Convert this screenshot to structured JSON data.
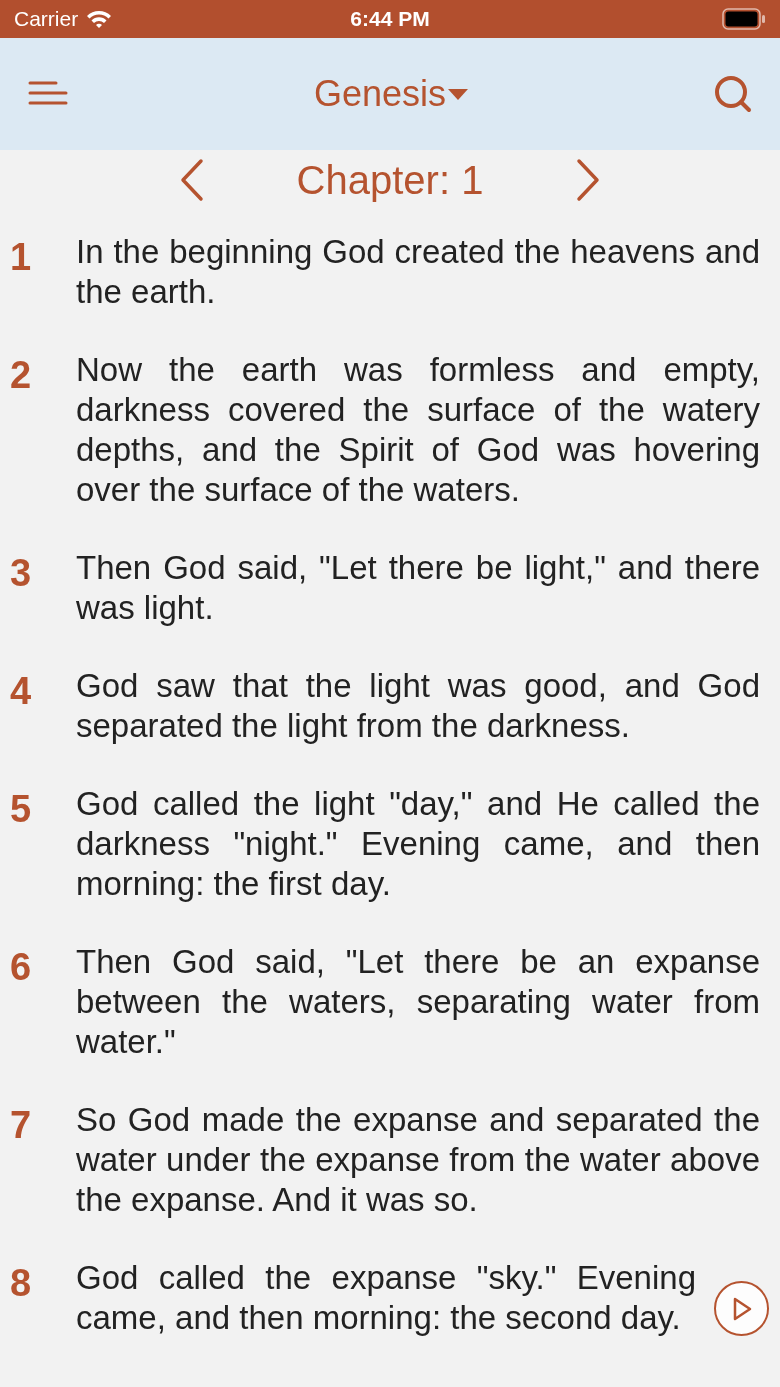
{
  "status_bar": {
    "carrier": "Carrier",
    "time": "6:44 PM"
  },
  "nav_bar": {
    "book": "Genesis"
  },
  "chapter_bar": {
    "label": "Chapter: 1"
  },
  "verses": [
    {
      "number": "1",
      "text": "In the beginning God created the heavens and the earth."
    },
    {
      "number": "2",
      "text": "Now the earth was formless and empty, darkness covered the surface of the watery depths, and the Spirit of God was hovering over the surface of the waters."
    },
    {
      "number": "3",
      "text": "Then God said, \"Let there be light,\" and there was light."
    },
    {
      "number": "4",
      "text": "God saw that the light was good, and God separated the light from the darkness."
    },
    {
      "number": "5",
      "text": "God called the light \"day,\" and He called the darkness \"night.\" Evening came, and then morning: the first day."
    },
    {
      "number": "6",
      "text": "Then God said, \"Let there be an expanse between the waters, separating water from water.\""
    },
    {
      "number": "7",
      "text": "So God made the expanse and separated the water under the expanse from the water above the expanse. And it was so."
    },
    {
      "number": "8",
      "text": "God called the expanse \"sky.\" Evening came, and then morning: the second day."
    }
  ]
}
